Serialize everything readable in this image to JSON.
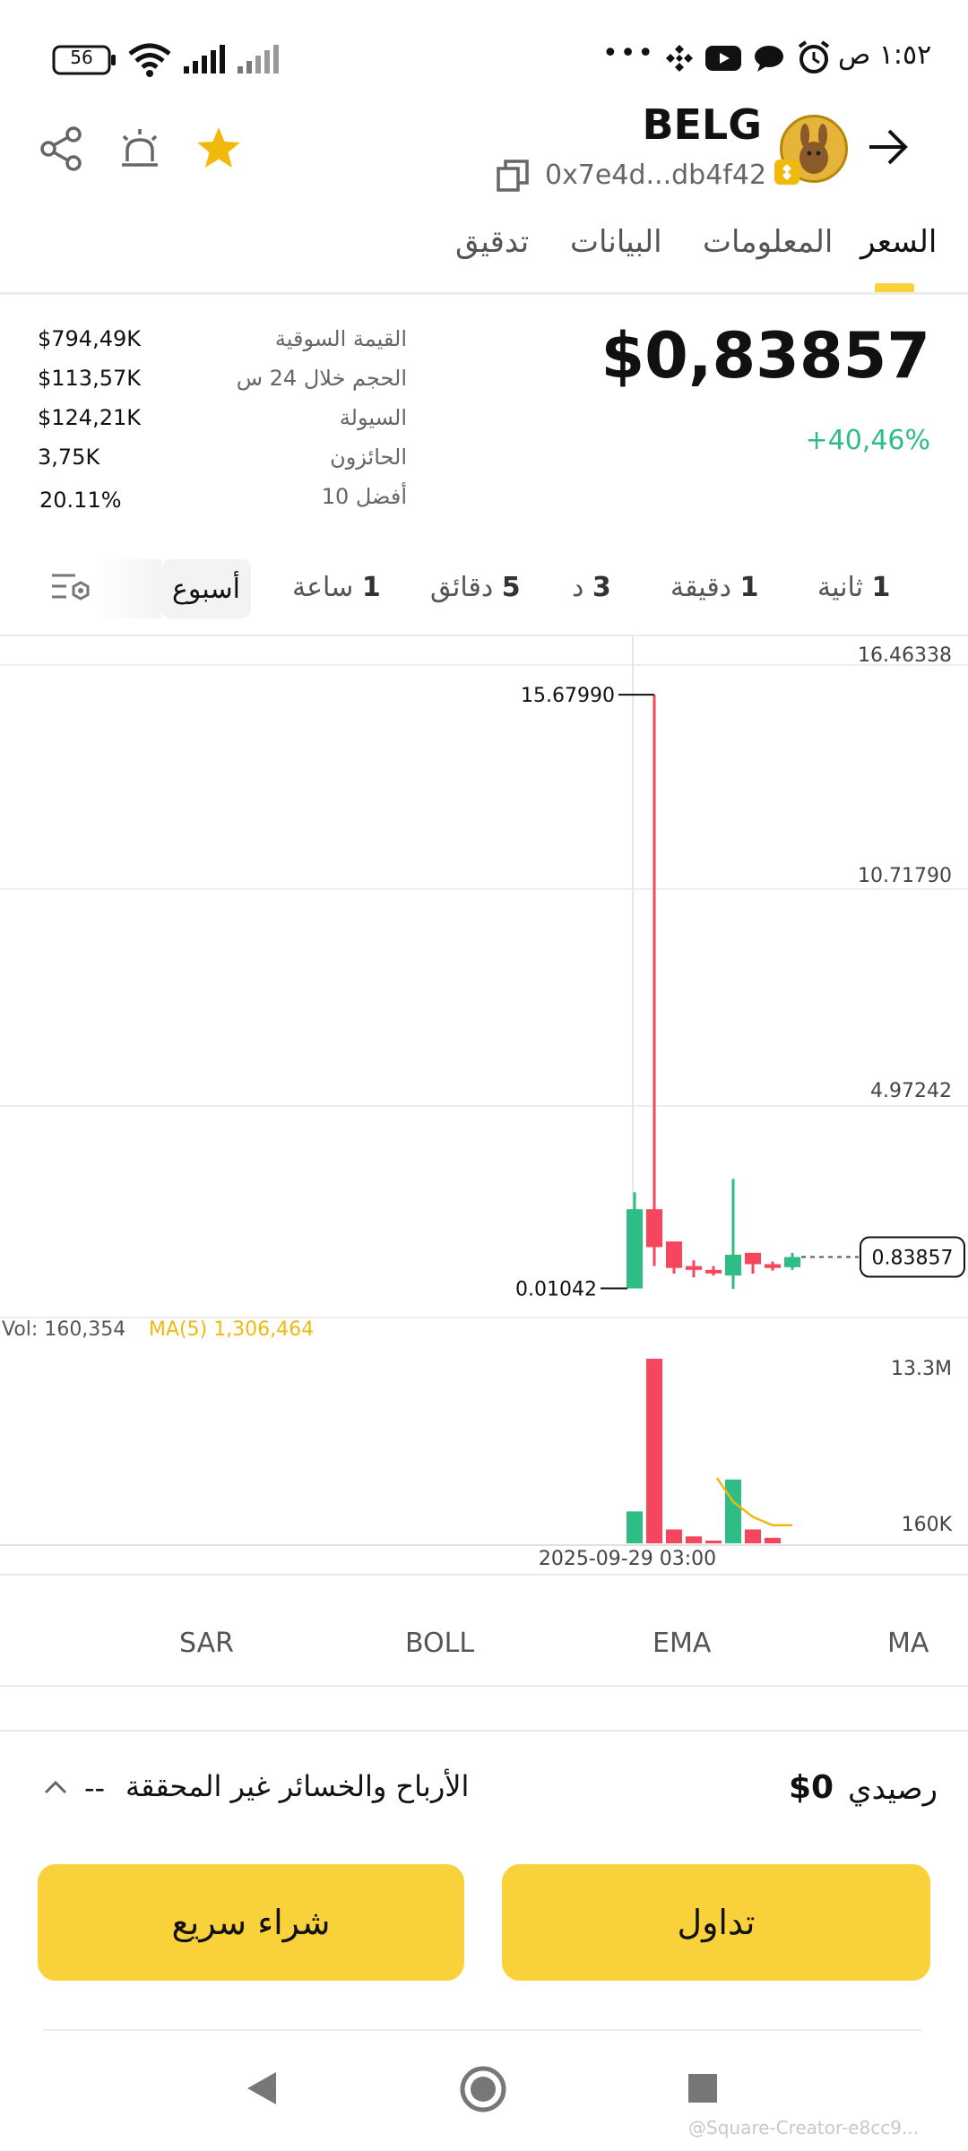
{
  "status_bar": {
    "time": "١:٥٢ ص",
    "battery": "56",
    "more": "•••"
  },
  "header": {
    "token_name": "BELG",
    "address": "0x7e4d...db4f42",
    "back_icon": "arrow-right-icon",
    "share_icon": "share-icon",
    "alert_icon": "alert-bell-icon",
    "favorite_icon": "star-icon"
  },
  "tabs": [
    {
      "label": "السعر",
      "active": true
    },
    {
      "label": "المعلومات",
      "active": false
    },
    {
      "label": "البيانات",
      "active": false
    },
    {
      "label": "تدقيق",
      "active": false
    }
  ],
  "price": {
    "value": "$0,83857",
    "change": "+40,46%",
    "change_color": "#2EBD85"
  },
  "stats": [
    {
      "label": "القيمة السوقية",
      "value": "$794,49K"
    },
    {
      "label": "الحجم خلال 24 س",
      "value": "$113,57K"
    },
    {
      "label": "السيولة",
      "value": "$124,21K"
    },
    {
      "label": "الحائزون",
      "value": "3,75K"
    },
    {
      "label": "أفضل 10",
      "value": "20.11%"
    }
  ],
  "timeframes": {
    "t1": {
      "num": "1",
      "unit": "ثانية"
    },
    "t2": {
      "num": "1",
      "unit": "دقيقة"
    },
    "t3": {
      "num": "3",
      "unit": "د"
    },
    "t4": {
      "num": "5",
      "unit": "دقائق"
    },
    "t5": {
      "num": "1",
      "unit": "ساعة"
    },
    "t6": {
      "label": "أسبوع",
      "active": true
    }
  },
  "chart_data": {
    "type": "candlestick",
    "y_axis_labels": [
      "16.46338",
      "10.71790",
      "4.97242"
    ],
    "ylim": [
      0,
      16.46338
    ],
    "high_label": "15.67990",
    "low_label": "0.01042",
    "current_price_label": "0.83857",
    "date_label": "2025-09-29 03:00",
    "candles": [
      {
        "open": 0.01042,
        "close": 2.1,
        "high": 2.55,
        "low": 0.01042,
        "dir": "up"
      },
      {
        "open": 2.1,
        "close": 1.1,
        "high": 15.6799,
        "low": 0.6,
        "dir": "down"
      },
      {
        "open": 1.25,
        "close": 0.55,
        "high": 1.25,
        "low": 0.4,
        "dir": "down"
      },
      {
        "open": 0.6,
        "close": 0.5,
        "high": 0.75,
        "low": 0.3,
        "dir": "down"
      },
      {
        "open": 0.5,
        "close": 0.42,
        "high": 0.6,
        "low": 0.35,
        "dir": "down"
      },
      {
        "open": 0.35,
        "close": 0.9,
        "high": 2.9,
        "low": 0.0,
        "dir": "up"
      },
      {
        "open": 0.95,
        "close": 0.65,
        "high": 0.95,
        "low": 0.4,
        "dir": "down"
      },
      {
        "open": 0.65,
        "close": 0.55,
        "high": 0.72,
        "low": 0.48,
        "dir": "down"
      },
      {
        "open": 0.57,
        "close": 0.83857,
        "high": 0.95,
        "low": 0.5,
        "dir": "up"
      }
    ],
    "volume": {
      "label_vol": "Vol: 160,354",
      "label_ma": "MA(5) 1,306,464",
      "ma_color": "#F0B90B",
      "axis_labels": [
        "13.3M",
        "160K"
      ],
      "bars": [
        {
          "value": 2300000,
          "dir": "up"
        },
        {
          "value": 13300000,
          "dir": "down"
        },
        {
          "value": 1000000,
          "dir": "down"
        },
        {
          "value": 500000,
          "dir": "down"
        },
        {
          "value": 200000,
          "dir": "down"
        },
        {
          "value": 4600000,
          "dir": "up"
        },
        {
          "value": 1000000,
          "dir": "down"
        },
        {
          "value": 400000,
          "dir": "down"
        }
      ],
      "ma_line": [
        4700000,
        3000000,
        1900000,
        1300000,
        1306464
      ]
    },
    "up_color": "#2EBD85",
    "down_color": "#F6465D"
  },
  "indicators": [
    "MA",
    "EMA",
    "BOLL",
    "SAR"
  ],
  "pnl": {
    "balance_label": "رصيدي",
    "balance_value": "$0",
    "unrealized_label": "الأرباح والخسائر غير المحققة",
    "unrealized_value": "--"
  },
  "buttons": {
    "trade": "تداول",
    "quick_buy": "شراء سريع"
  },
  "watermark": "@Square-Creator-e8cc9..."
}
